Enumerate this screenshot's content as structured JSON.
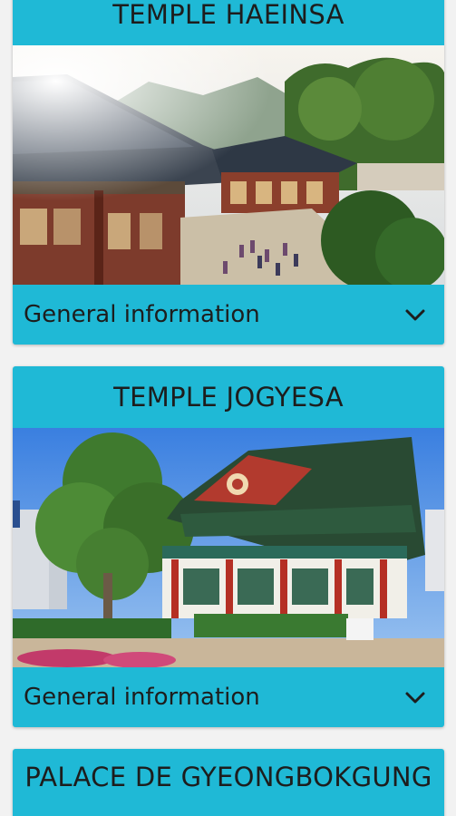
{
  "cards": [
    {
      "title": "TEMPLE HAEINSA",
      "info_label": "General information",
      "icon": "chevron-down-icon"
    },
    {
      "title": "TEMPLE JOGYESA",
      "info_label": "General information",
      "icon": "chevron-down-icon"
    },
    {
      "title": "PALACE DE GYEONGBOKGUNG"
    }
  ],
  "colors": {
    "card": "#1fb9d6",
    "background": "#f2f2f2",
    "text": "#1d1d1d"
  }
}
